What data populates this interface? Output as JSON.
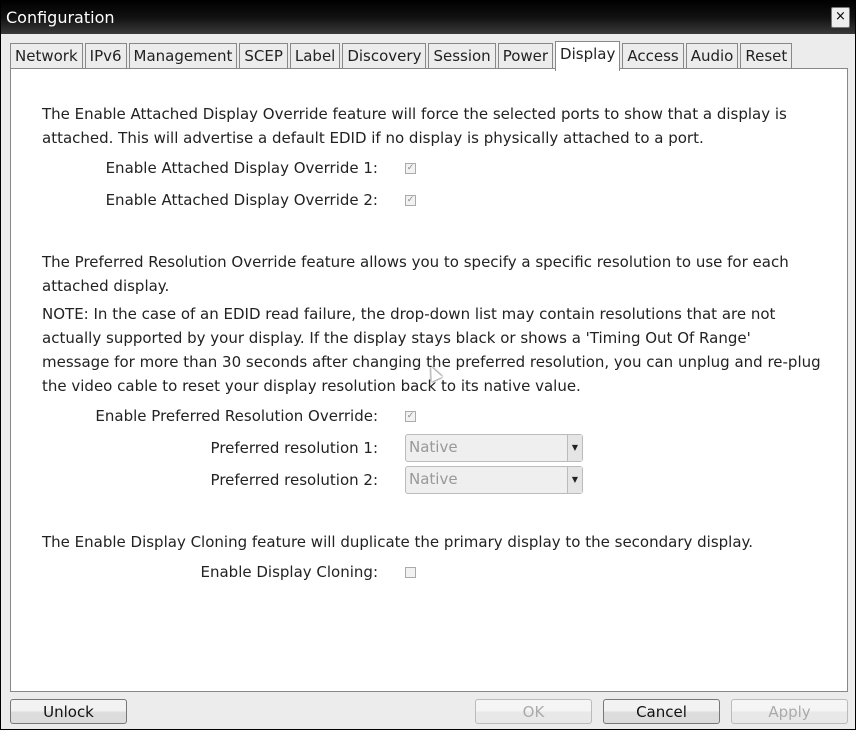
{
  "window": {
    "title": "Configuration",
    "close_label": "×"
  },
  "tabs": [
    {
      "label": "Network",
      "active": false
    },
    {
      "label": "IPv6",
      "active": false
    },
    {
      "label": "Management",
      "active": false
    },
    {
      "label": "SCEP",
      "active": false
    },
    {
      "label": "Label",
      "active": false
    },
    {
      "label": "Discovery",
      "active": false
    },
    {
      "label": "Session",
      "active": false
    },
    {
      "label": "Power",
      "active": false
    },
    {
      "label": "Display",
      "active": true
    },
    {
      "label": "Access",
      "active": false
    },
    {
      "label": "Audio",
      "active": false
    },
    {
      "label": "Reset",
      "active": false
    }
  ],
  "display": {
    "attached_intro": "The Enable Attached Display Override feature will force the selected ports to show that a display is attached. This will advertise a default EDID if no display is physically attached to a port.",
    "attached_1": {
      "label": "Enable Attached Display Override 1:",
      "checked": true
    },
    "attached_2": {
      "label": "Enable Attached Display Override 2:",
      "checked": true
    },
    "preferred_intro": "The Preferred Resolution Override feature allows you to specify a specific resolution to use for each attached display.",
    "preferred_note": "NOTE: In the case of an EDID read failure, the drop-down list may contain resolutions that are not actually supported by your display. If the display stays black or shows a 'Timing Out Of Range' message for more than 30 seconds after changing the preferred resolution, you can unplug and re-plug the video cable to reset your display resolution back to its native value.",
    "preferred_enable": {
      "label": "Enable Preferred Resolution Override:",
      "checked": true
    },
    "resolution_1": {
      "label": "Preferred resolution 1:",
      "value": "Native"
    },
    "resolution_2": {
      "label": "Preferred resolution 2:",
      "value": "Native"
    },
    "cloning_intro": "The Enable Display Cloning feature will duplicate the primary display to the secondary display.",
    "cloning": {
      "label": "Enable Display Cloning:",
      "checked": false
    }
  },
  "footer": {
    "unlock": "Unlock",
    "ok": "OK",
    "cancel": "Cancel",
    "apply": "Apply"
  },
  "icons": {
    "check": "✓",
    "dropdown": "▼"
  }
}
